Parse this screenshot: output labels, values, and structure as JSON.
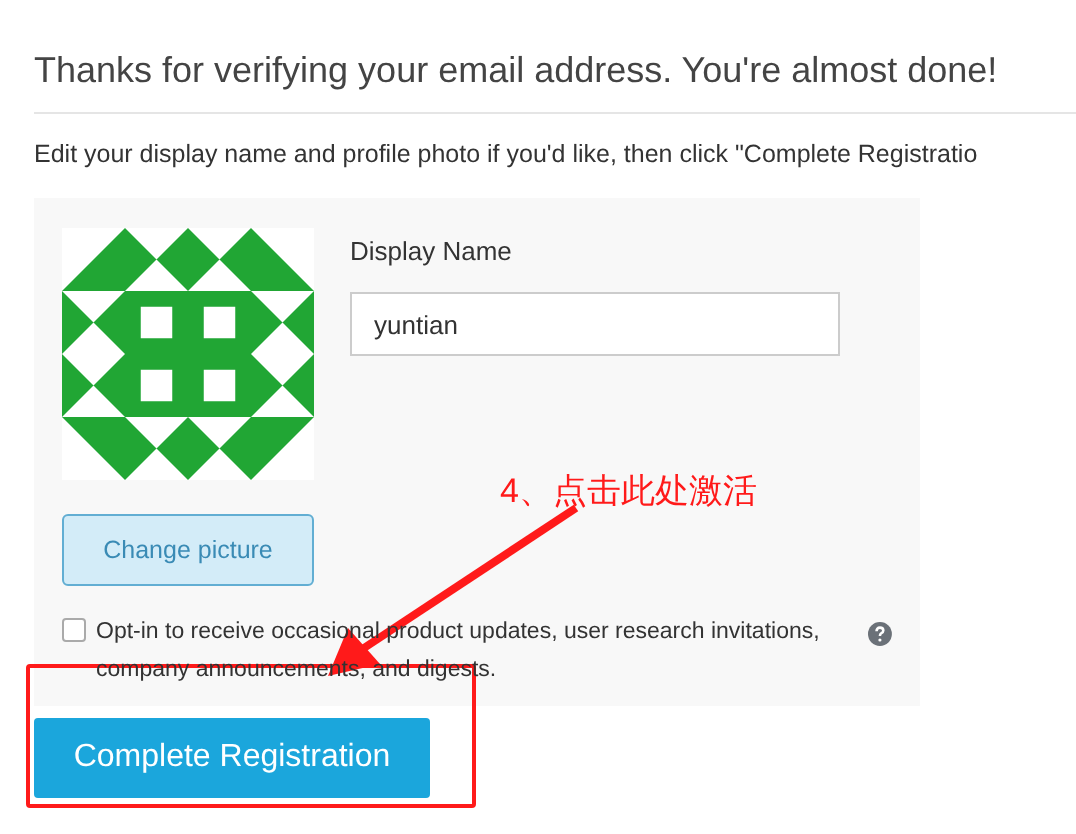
{
  "heading": "Thanks for verifying your email address. You're almost done!",
  "instructions": "Edit your display name and profile photo if you'd like, then click \"Complete Registratio",
  "profile": {
    "display_name_label": "Display Name",
    "display_name_value": "yuntian",
    "change_picture_button": "Change picture"
  },
  "opt_in": {
    "checked": false,
    "label": "Opt-in to receive occasional product updates, user research invitations, company announcements, and digests."
  },
  "submit_button": "Complete Registration",
  "annotation": {
    "text": "4、点击此处激活"
  }
}
